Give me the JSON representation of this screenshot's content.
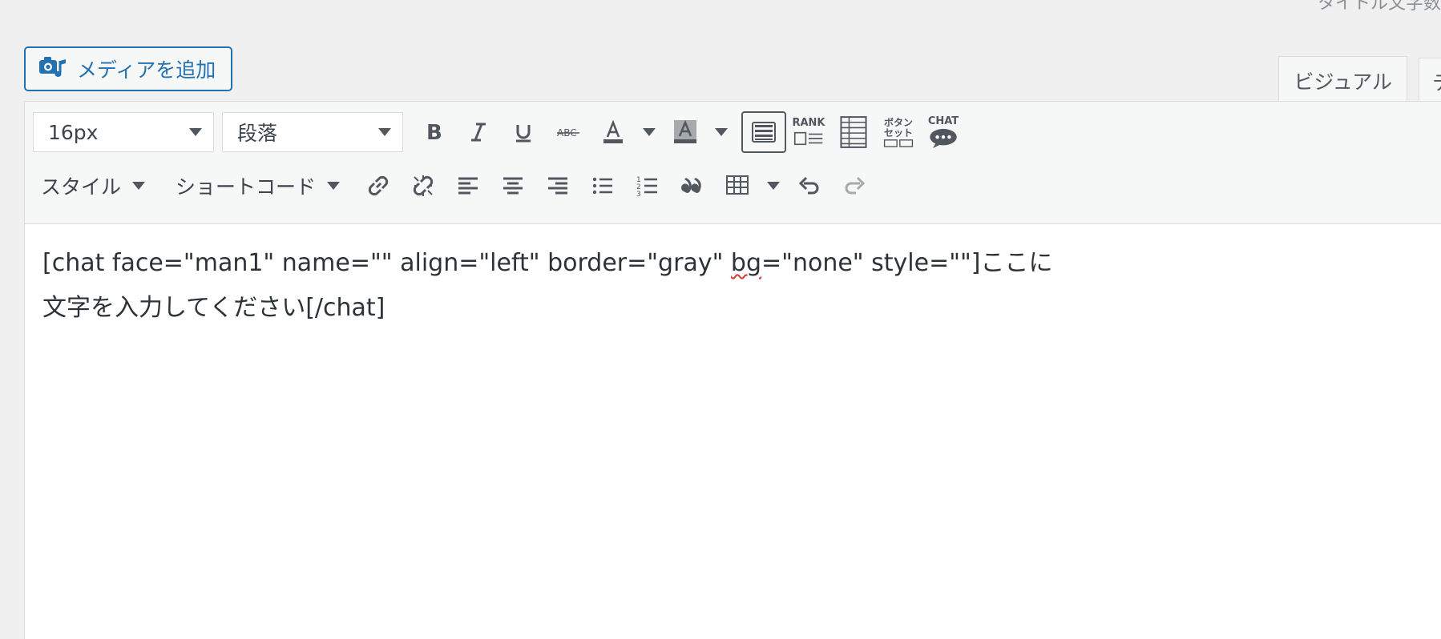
{
  "header": {
    "media_button_label": "メディアを追加",
    "tabs": [
      {
        "label": "ビジュアル",
        "active": true
      },
      {
        "label": "テ",
        "active": false
      }
    ],
    "top_note": "タイトル文字数"
  },
  "toolbar": {
    "font_size_value": "16px",
    "format_value": "段落",
    "style_menu_label": "スタイル",
    "shortcode_menu_label": "ショートコード",
    "rank_label": "RANK",
    "button_set_label_1": "ボタン",
    "button_set_label_2": "セット",
    "chat_label": "CHAT"
  },
  "content": {
    "line_1_pre": "[chat face=\"man1\" name=\"\" align=\"left\" border=\"gray\" ",
    "line_1_misspelled": "bg",
    "line_1_post": "=\"none\" style=\"\"]ここに",
    "line_2": "文字を入力してください[/chat]"
  },
  "colors": {
    "accent": "#2271b1",
    "toolbar_bg": "#f6f7f7",
    "page_bg": "#f0f0f1",
    "spellcheck": "#d63638"
  }
}
